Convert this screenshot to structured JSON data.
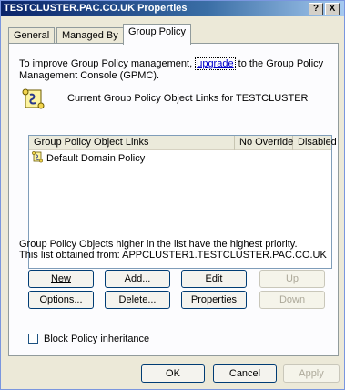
{
  "window": {
    "title": "TESTCLUSTER.PAC.CO.UK Properties",
    "help_glyph": "?",
    "close_glyph": "X"
  },
  "tabs": [
    {
      "label": "General",
      "active": false
    },
    {
      "label": "Managed By",
      "active": false
    },
    {
      "label": "Group Policy",
      "active": true
    }
  ],
  "intro": {
    "text_before": "To improve Group Policy management, ",
    "link": "upgrade",
    "text_after": " to the Group Policy Management Console (GPMC)."
  },
  "current_links_label": "Current Group Policy Object Links for TESTCLUSTER",
  "gpo_list": {
    "columns": [
      "Group Policy Object Links",
      "No Override",
      "Disabled"
    ],
    "rows": [
      {
        "name": "Default Domain Policy",
        "no_override": "",
        "disabled": ""
      }
    ]
  },
  "notes": {
    "priority": "Group Policy Objects higher in the list have the highest priority.",
    "obtained_from": "This list obtained from: APPCLUSTER1.TESTCLUSTER.PAC.CO.UK"
  },
  "buttons": {
    "new": "New",
    "add": "Add...",
    "edit": "Edit",
    "up": "Up",
    "options": "Options...",
    "delete": "Delete...",
    "properties": "Properties",
    "down": "Down",
    "ok": "OK",
    "cancel": "Cancel",
    "apply": "Apply"
  },
  "block_inheritance": {
    "label": "Block Policy inheritance",
    "checked": false
  },
  "colors": {
    "titlebar": "#0a246a",
    "face": "#ece9d8",
    "link": "#0000cc"
  },
  "icons": [
    "help-icon",
    "close-icon",
    "gpo-scroll-icon"
  ]
}
